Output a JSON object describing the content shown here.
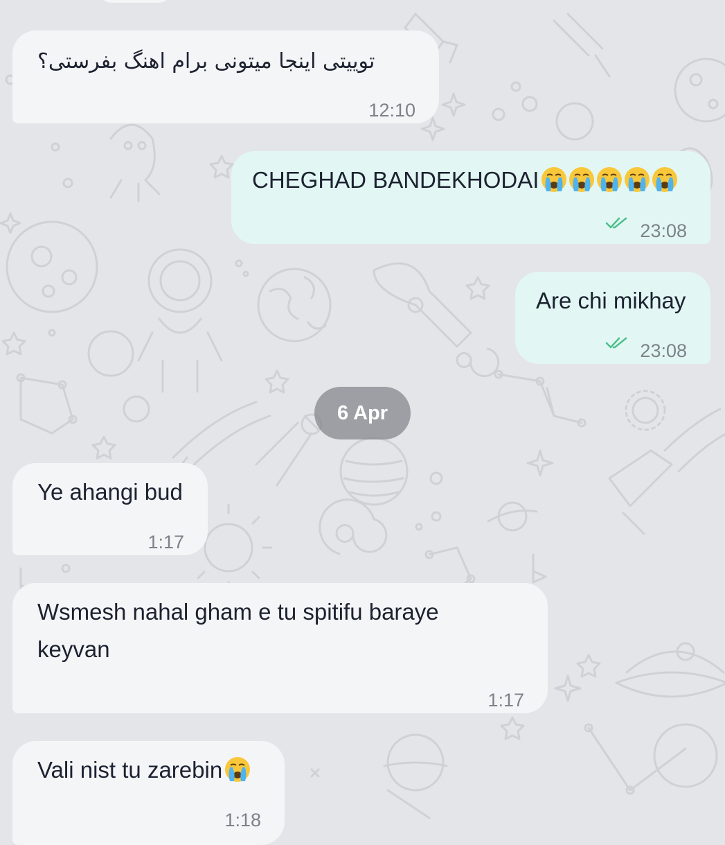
{
  "chat": {
    "date_separator": "6 Apr",
    "messages": [
      {
        "direction": "incoming",
        "text": "توییتی اینجا میتونی برام اهنگ بفرستی؟",
        "time": "12:10"
      },
      {
        "direction": "outgoing",
        "text": "CHEGHAD BANDEKHODAI",
        "emoji": "crying-face x5",
        "time": "23:08",
        "status": "read"
      },
      {
        "direction": "outgoing",
        "text": "Are chi mikhay",
        "time": "23:08",
        "status": "read"
      },
      {
        "direction": "incoming",
        "text": "Ye ahangi bud",
        "time": "1:17"
      },
      {
        "direction": "incoming",
        "text_line1": "Wsmesh nahal gham e tu spitifu baraye",
        "text_line2": "keyvan",
        "time": "1:17"
      },
      {
        "direction": "incoming",
        "text": "Vali nist tu zarebin",
        "emoji": "crying-face",
        "time": "1:18"
      }
    ]
  },
  "colors": {
    "background": "#e4e5e9",
    "incoming_bubble": "#f4f5f7",
    "outgoing_bubble": "#e2f7f4",
    "read_ticks": "#4fbf8a",
    "time_text": "#7d8189",
    "date_pill": "#82848a"
  }
}
